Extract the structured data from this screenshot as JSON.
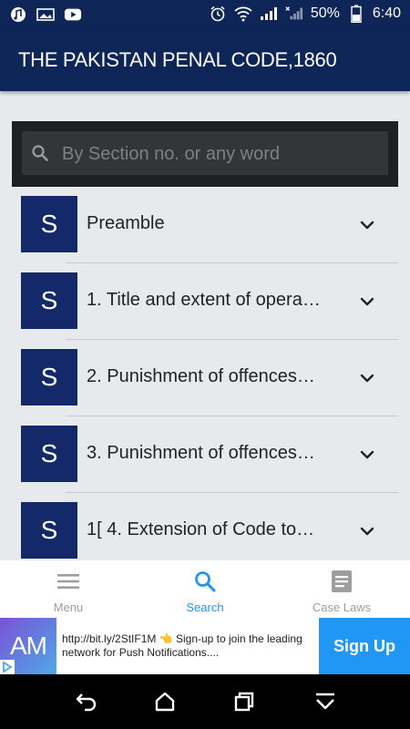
{
  "status_bar": {
    "battery": "50%",
    "time": "6:40",
    "left_icons": [
      "music-icon",
      "gallery-icon",
      "youtube-icon"
    ],
    "right_icons": [
      "alarm-icon",
      "wifi-icon",
      "signal-icon",
      "signal-x-icon",
      "battery-icon"
    ]
  },
  "app_bar": {
    "title": "THE PAKISTAN PENAL CODE,1860"
  },
  "search": {
    "placeholder": "By Section no. or any word",
    "value": ""
  },
  "sections": [
    {
      "avatar": "S",
      "label": "Preamble"
    },
    {
      "avatar": "S",
      "label": "1. Title and extent of opera…"
    },
    {
      "avatar": "S",
      "label": "2. Punishment of offences…"
    },
    {
      "avatar": "S",
      "label": "3. Punishment of offences…"
    },
    {
      "avatar": "S",
      "label": "1[ 4. Extension of Code to…"
    }
  ],
  "bottom_nav": [
    {
      "label": "Menu",
      "icon": "menu-icon",
      "active": false
    },
    {
      "label": "Search",
      "icon": "search-icon",
      "active": true
    },
    {
      "label": "Case Laws",
      "icon": "document-icon",
      "active": false
    }
  ],
  "ad": {
    "logo_text": "AM",
    "text": "http://bit.ly/2StIF1M 👈 Sign-up to join the leading network for Push Notifications....",
    "button": "Sign Up"
  },
  "colors": {
    "primary": "#0d2557",
    "avatar": "#13296a",
    "accent": "#2196f3"
  }
}
